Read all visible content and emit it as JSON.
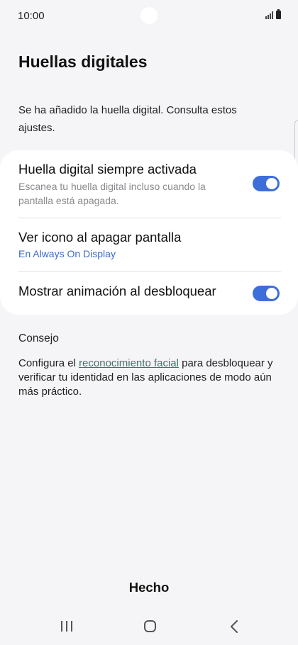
{
  "status_bar": {
    "time": "10:00"
  },
  "page": {
    "title": "Huellas digitales",
    "intro": "Se ha añadido la huella digital. Consulta estos ajustes."
  },
  "settings": [
    {
      "title": "Huella digital siempre activada",
      "description": "Escanea tu huella digital incluso cuando la pantalla está apagada.",
      "toggle_on": true
    },
    {
      "title": "Ver icono al apagar pantalla",
      "subtitle": "En Always On Display"
    },
    {
      "title": "Mostrar animación al desbloquear",
      "toggle_on": true
    }
  ],
  "tip": {
    "heading": "Consejo",
    "text_before": "Configura el ",
    "link": "reconocimiento facial",
    "text_after": " para desbloquear y verificar tu identidad en las aplicaciones de modo aún más práctico."
  },
  "footer": {
    "done_label": "Hecho"
  },
  "colors": {
    "accent": "#3e6ed8",
    "link": "#2f7d69",
    "subtitle": "#3d6ac9",
    "background": "#f5f5f7"
  },
  "icons": {
    "nav": [
      "recent-apps-icon",
      "home-icon",
      "back-icon"
    ],
    "status": [
      "signal-icon",
      "battery-icon"
    ]
  }
}
